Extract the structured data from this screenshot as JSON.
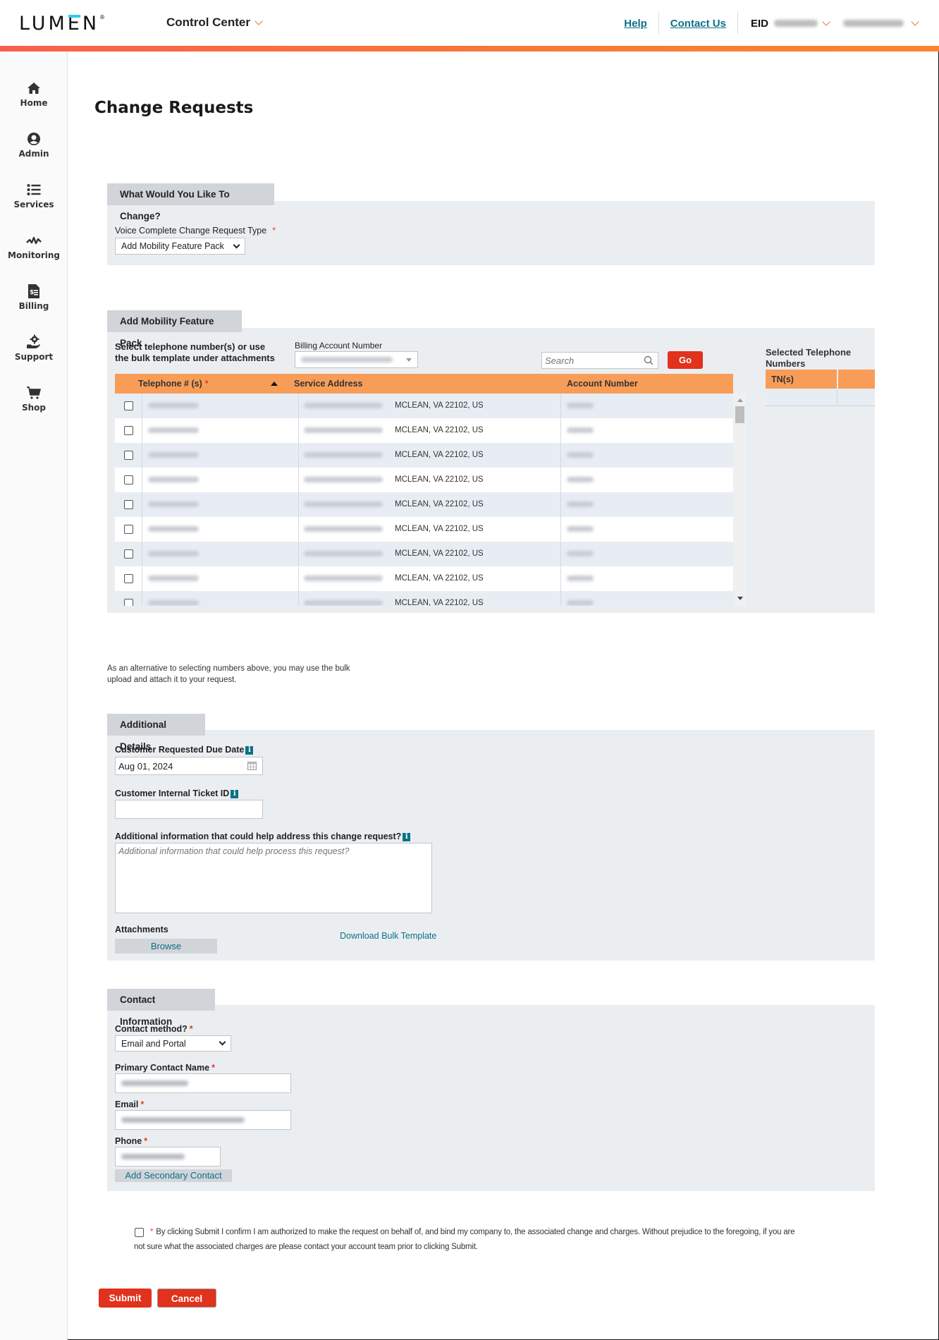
{
  "header": {
    "logo": "LUMEN",
    "app_switcher": "Control Center",
    "help": "Help",
    "contact_us": "Contact Us",
    "eid_label": "EID"
  },
  "sidebar": {
    "items": [
      {
        "label": "Home",
        "icon": "home-icon"
      },
      {
        "label": "Admin",
        "icon": "user-icon"
      },
      {
        "label": "Services",
        "icon": "list-icon"
      },
      {
        "label": "Monitoring",
        "icon": "pulse-icon"
      },
      {
        "label": "Billing",
        "icon": "invoice-icon"
      },
      {
        "label": "Support",
        "icon": "support-gear-icon"
      },
      {
        "label": "Shop",
        "icon": "cart-icon"
      }
    ]
  },
  "page": {
    "title": "Change Requests"
  },
  "change_type": {
    "tab": "What Would You Like To Change?",
    "label": "Voice Complete Change Request Type",
    "required": "*",
    "selected": "Add Mobility Feature Pack"
  },
  "feature_pack": {
    "tab": "Add Mobility Feature Pack",
    "instructions_line1": "Select telephone number(s) or use",
    "instructions_line2": "the bulk template under attachments",
    "ban_label": "Billing Account Number",
    "search_placeholder": "Search",
    "go": "Go",
    "columns": {
      "telephone": "Telephone # (s)",
      "telephone_required": "*",
      "service_address": "Service Address",
      "account_number": "Account Number"
    },
    "rows": [
      {
        "city": "MCLEAN, VA 22102, US"
      },
      {
        "city": "MCLEAN, VA 22102, US"
      },
      {
        "city": "MCLEAN, VA 22102, US"
      },
      {
        "city": "MCLEAN, VA 22102, US"
      },
      {
        "city": "MCLEAN, VA 22102, US"
      },
      {
        "city": "MCLEAN, VA 22102, US"
      },
      {
        "city": "MCLEAN, VA 22102, US"
      },
      {
        "city": "MCLEAN, VA 22102, US"
      },
      {
        "city": "MCLEAN, VA 22102, US"
      }
    ],
    "selected_title": "Selected Telephone Numbers",
    "selected_col": "TN(s)"
  },
  "alt_text": {
    "line1": "As an alternative to selecting numbers above, you may use the bulk",
    "line2": "upload and attach it to your request."
  },
  "additional": {
    "tab": "Additional Details",
    "due_date_label": "Customer Requested Due Date",
    "due_date_value": "Aug 01, 2024",
    "ticket_label": "Customer Internal Ticket ID",
    "ticket_value": "",
    "info_label": "Additional information that could help address this change request?",
    "info_placeholder": "Additional information that could help process this request?",
    "attachments_label": "Attachments",
    "browse": "Browse",
    "download_template": "Download Bulk Template"
  },
  "contact": {
    "tab": "Contact Information",
    "method_label": "Contact method?",
    "method_value": "Email and Portal",
    "name_label": "Primary Contact Name",
    "email_label": "Email",
    "phone_label": "Phone",
    "required": "*",
    "add_secondary": "Add Secondary Contact"
  },
  "consent": {
    "required": "*",
    "line1": "By clicking Submit I confirm I am authorized to make the request on behalf of, and bind my company to, the associated change and charges. Without prejudice to the foregoing, if you are",
    "line2": "not sure what the associated charges are please contact your account team prior to clicking Submit."
  },
  "actions": {
    "submit": "Submit",
    "cancel": "Cancel"
  }
}
